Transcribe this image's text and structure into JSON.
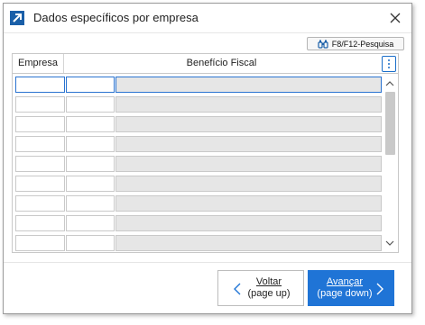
{
  "window": {
    "title": "Dados específicos por empresa",
    "app_icon": "arrow-northeast-icon",
    "close_icon": "close-icon"
  },
  "toolbar": {
    "search_label": "F8/F12-Pesquisa",
    "search_icon": "binoculars-icon"
  },
  "grid": {
    "columns": [
      "Empresa",
      "Benefício Fiscal"
    ],
    "menu_icon": "kebab-menu-icon",
    "rows": [
      {
        "empresa": "",
        "col2": "",
        "beneficio": ""
      },
      {
        "empresa": "",
        "col2": "",
        "beneficio": ""
      },
      {
        "empresa": "",
        "col2": "",
        "beneficio": ""
      },
      {
        "empresa": "",
        "col2": "",
        "beneficio": ""
      },
      {
        "empresa": "",
        "col2": "",
        "beneficio": ""
      },
      {
        "empresa": "",
        "col2": "",
        "beneficio": ""
      },
      {
        "empresa": "",
        "col2": "",
        "beneficio": ""
      },
      {
        "empresa": "",
        "col2": "",
        "beneficio": ""
      },
      {
        "empresa": "",
        "col2": "",
        "beneficio": ""
      }
    ]
  },
  "footer": {
    "back_line1": "Voltar",
    "back_line2": "(page up)",
    "next_line1": "Avançar",
    "next_line2": "(page down)"
  },
  "colors": {
    "accent": "#1f74d6",
    "readonly_cell": "#e6e6e6"
  }
}
